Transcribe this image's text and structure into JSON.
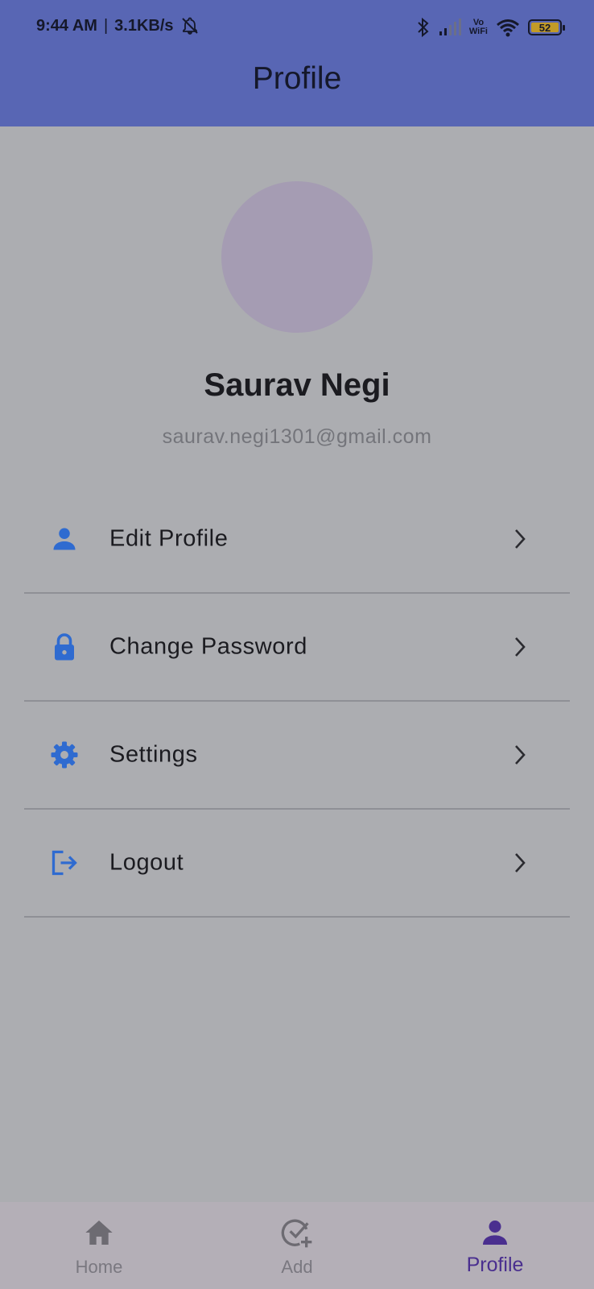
{
  "status_bar": {
    "time": "9:44 AM",
    "separator": "|",
    "network_speed": "3.1KB/s",
    "vowifi_line1": "Vo",
    "vowifi_line2": "WiFi",
    "battery_level": "52",
    "battery_color": "#c29b27"
  },
  "appbar": {
    "title": "Profile",
    "color": "#5866b4"
  },
  "profile": {
    "name": "Saurav Negi",
    "email": "saurav.negi1301@gmail.com",
    "avatar_color": "#a59cb3"
  },
  "menu": {
    "icon_color": "#2f6bd0",
    "items": [
      {
        "label": "Edit Profile",
        "icon": "person-icon"
      },
      {
        "label": "Change Password",
        "icon": "lock-icon"
      },
      {
        "label": "Settings",
        "icon": "gear-icon"
      },
      {
        "label": "Logout",
        "icon": "logout-icon"
      }
    ]
  },
  "bottom_nav": {
    "items": [
      {
        "label": "Home",
        "icon": "home-icon",
        "active": false
      },
      {
        "label": "Add",
        "icon": "add-task-icon",
        "active": false
      },
      {
        "label": "Profile",
        "icon": "person-icon",
        "active": true
      }
    ],
    "active_color": "#4a2f8f"
  }
}
